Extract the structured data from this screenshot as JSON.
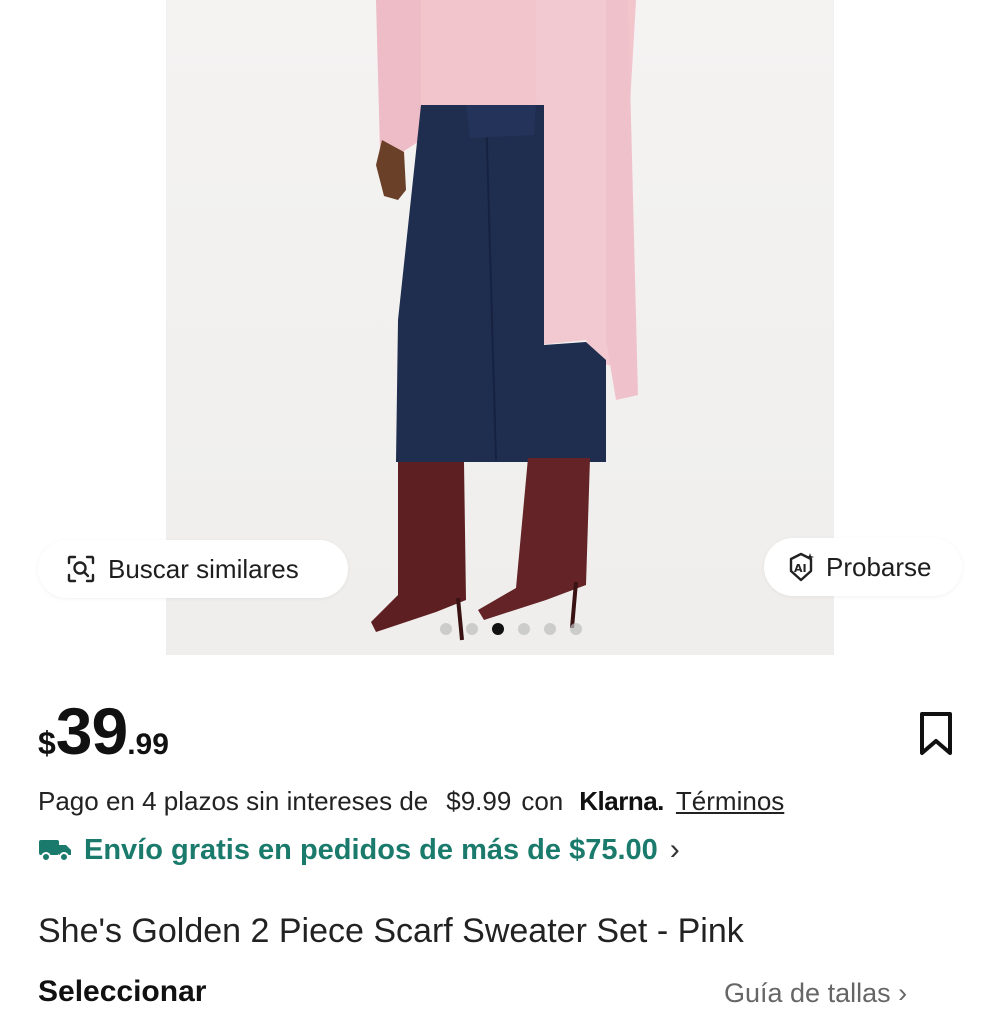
{
  "gallery": {
    "similar_button": "Buscar similares",
    "similar_icon": "image-search-icon",
    "tryon_button": "Probarse",
    "tryon_icon": "ai-sparkle-icon",
    "slide_count": 6,
    "active_slide": 2
  },
  "price": {
    "currency": "$",
    "integer": "39",
    "decimal": ".99"
  },
  "save_icon": "bookmark-icon",
  "installments": {
    "text": "Pago en 4 plazos sin intereses de",
    "amount": "$9.99",
    "connector": "con",
    "provider": "Klarna.",
    "terms_link": "Términos"
  },
  "shipping": {
    "icon": "delivery-truck-icon",
    "text": "Envío gratis en pedidos de más de $75.00",
    "chevron": "›",
    "color": "#1a7a6c"
  },
  "product": {
    "title": "She's Golden 2 Piece Scarf Sweater Set - Pink",
    "select_label": "Seleccionar",
    "size_guide": "Guía de tallas ›"
  }
}
